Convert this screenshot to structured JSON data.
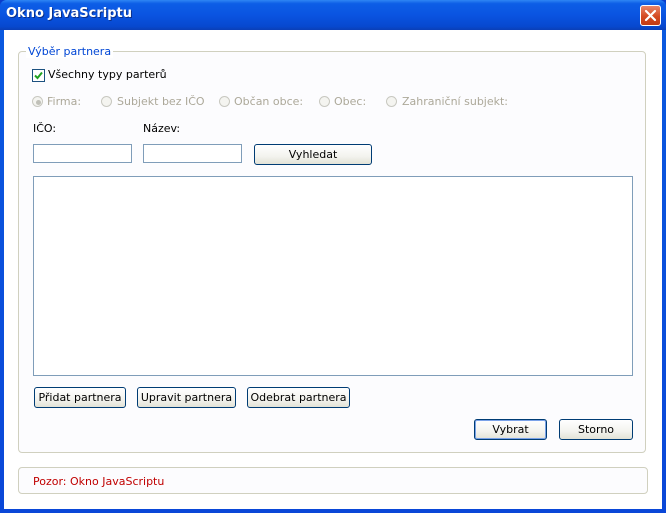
{
  "window": {
    "title": "Okno JavaScriptu"
  },
  "group": {
    "legend": "Výběr partnera",
    "all_types_checkbox": {
      "label": "Všechny typy parterů",
      "checked": true
    },
    "partner_types": [
      {
        "label": "Firma:",
        "selected": true,
        "enabled": false
      },
      {
        "label": "Subjekt bez IČO",
        "selected": false,
        "enabled": false
      },
      {
        "label": "Občan obce:",
        "selected": false,
        "enabled": false
      },
      {
        "label": "Obec:",
        "selected": false,
        "enabled": false
      },
      {
        "label": "Zahraniční subjekt:",
        "selected": false,
        "enabled": false
      }
    ],
    "ico_label": "IČO:",
    "ico_value": "",
    "nazev_label": "Název:",
    "nazev_value": "",
    "search_button": "Vyhledat",
    "results": [],
    "add_button": "Přidat partnera",
    "edit_button": "Upravit partnera",
    "remove_button": "Odebrat partnera",
    "select_button": "Vybrat",
    "cancel_button": "Storno"
  },
  "status": {
    "text": "Pozor: Okno JavaScriptu"
  },
  "colors": {
    "titlebar": "#0a54e1",
    "legend": "#0046d5",
    "status_text": "#c00000",
    "close_button": "#d44a21"
  },
  "icons": {
    "close": "close-icon",
    "check": "checkmark-icon"
  }
}
